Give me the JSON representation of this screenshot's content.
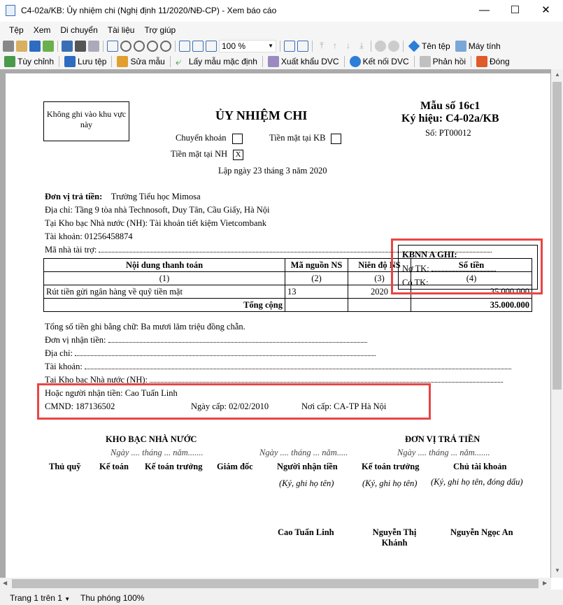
{
  "window": {
    "title": "C4-02a/KB: Ủy nhiệm chi (Nghị định 11/2020/NĐ-CP) - Xem báo cáo"
  },
  "menu": [
    "Tệp",
    "Xem",
    "Di chuyển",
    "Tài liệu",
    "Trợ giúp"
  ],
  "toolbar": {
    "zoom": "100 %",
    "file_name": "Tên tệp",
    "calculator": "Máy tính"
  },
  "toolbar2": [
    "Tùy chỉnh",
    "Lưu tệp",
    "Sửa mẫu",
    "Lấy mẫu mặc định",
    "Xuất khẩu DVC",
    "Kết nối DVC",
    "Phản hồi",
    "Đóng"
  ],
  "doc": {
    "no_write": "Không ghi vào khu vực này",
    "title": "ỦY NHIỆM CHI",
    "form_no": "Mẫu số 16c1",
    "symbol": "Ký hiệu: C4-02a/KB",
    "number": "Số: PT00012",
    "transfer": "Chuyển khoản",
    "cash_kb": "Tiền mặt tại KB",
    "cash_nh": "Tiền mặt tại NH",
    "cash_nh_mark": "X",
    "date": "Lập ngày 23 tháng 3 năm 2020",
    "payer_label": "Đơn vị trả tiền:",
    "payer": "Trường Tiểu học Mimosa",
    "address": "Địa chỉ: Tầng 9 tòa nhà Technosoft, Duy Tân, Cầu Giấy, Hà Nội",
    "treasury": "Tại Kho bạc Nhà nước (NH): Tài khoản tiết kiệm Vietcombank",
    "account": "Tài khoản: 01256458874",
    "sponsor": "Mã nhà tài trợ:",
    "table": {
      "headers": [
        "Nội dung thanh toán",
        "Mã nguồn NS",
        "Niên độ NS",
        "Số tiền"
      ],
      "index": [
        "(1)",
        "(2)",
        "(3)",
        "(4)"
      ],
      "rows": [
        [
          "Rút tiền gửi ngân hàng về quỹ tiền mặt",
          "13",
          "2020",
          "35.000.000"
        ]
      ],
      "total_label": "Tổng cộng",
      "total": "35.000.000"
    },
    "in_words": "Tổng số tiền ghi bằng chữ: Ba mươi lăm triệu đồng chẵn.",
    "recv_unit": "Đơn vị nhận tiền:",
    "recv_addr": "Địa chỉ:",
    "recv_acc": "Tài khoản:",
    "recv_treasury": "Tại Kho bạc Nhà nước (NH):",
    "kbnn": "KBNN A GHI:",
    "debit": "Nợ TK:",
    "credit": "Có TK:",
    "receiver": "Hoặc người nhận tiền: Cao Tuấn Linh",
    "id_no": "CMND: 187136502",
    "issue_date": "Ngày cấp: 02/02/2010",
    "issue_place": "Nơi cấp: CA-TP Hà Nội",
    "kb_title": "KHO BẠC NHÀ NƯỚC",
    "payer_title": "ĐƠN VỊ TRẢ TIỀN",
    "date_blank": "Ngày .... tháng ... năm.......",
    "date_blank2": "Ngày .... tháng ... năm.....",
    "date_blank3": "Ngày .... tháng ... năm.......",
    "roles": [
      "Thủ quỹ",
      "Kế toán",
      "Kế toán trưởng",
      "Giám đốc",
      "Người nhận tiền",
      "Kế toán trưởng",
      "Chủ tài khoản"
    ],
    "sign_hint": "(Ký, ghi họ tên)",
    "sign_hint2": "(Ký, ghi họ tên)",
    "sign_hint3": "(Ký, ghi họ tên, đóng dấu)",
    "names": [
      "Cao Tuấn Linh",
      "Nguyễn Thị Khánh",
      "Nguyễn Ngọc An"
    ]
  },
  "status": {
    "page": "Trang 1 trên 1",
    "zoom": "Thu phóng 100%"
  }
}
